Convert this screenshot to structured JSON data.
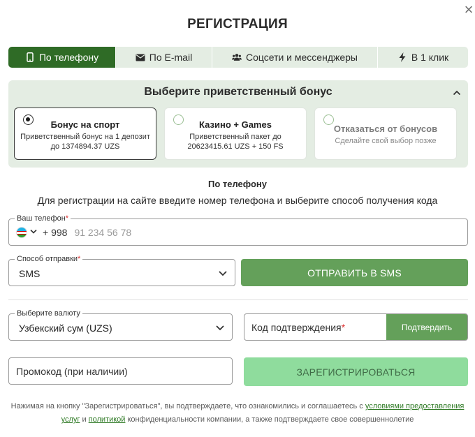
{
  "dialog": {
    "title": "РЕГИСТРАЦИЯ",
    "close_icon": "close-icon"
  },
  "tabs": [
    {
      "label": "По телефону",
      "icon": "phone-icon",
      "active": true
    },
    {
      "label": "По E-mail",
      "icon": "envelope-icon",
      "active": false
    },
    {
      "label": "Соцсети и мессенджеры",
      "icon": "users-icon",
      "active": false
    },
    {
      "label": "В 1 клик",
      "icon": "lightning-icon",
      "active": false
    }
  ],
  "bonus": {
    "title": "Выберите приветственный бонус",
    "options": [
      {
        "title": "Бонус на спорт",
        "desc": "Приветственный бонус на 1 депозит до 1374894.37 UZS",
        "selected": true
      },
      {
        "title": "Казино + Games",
        "desc": "Приветственный пакет до 20623415.61 UZS + 150 FS",
        "selected": false
      },
      {
        "title": "Отказаться от бонусов",
        "desc": "Сделайте свой выбор позже",
        "selected": false
      }
    ]
  },
  "section": {
    "title": "По телефону",
    "description": "Для регистрации на сайте введите номер телефона и выберите способ получения кода"
  },
  "phone": {
    "label": "Ваш телефон",
    "required_mark": "*",
    "country_code": "+ 998",
    "placeholder": "91 234 56 78"
  },
  "send_method": {
    "label": "Способ отправки",
    "required_mark": "*",
    "value": "SMS"
  },
  "send_button": {
    "label": "ОТПРАВИТЬ В SMS"
  },
  "currency": {
    "label": "Выберите валюту",
    "value": "Узбекский сум (UZS)"
  },
  "confirmation": {
    "label": "Код подтверждения",
    "required_mark": "*",
    "button": "Подтвердить"
  },
  "promo": {
    "label": "Промокод (при наличии)"
  },
  "register_button": {
    "label": "ЗАРЕГИСТРИРОВАТЬСЯ"
  },
  "legal": {
    "text_before": "Нажимая на кнопку \"Зарегистрироваться\", вы подтверждаете, что ознакомились и соглашаетесь с ",
    "link_terms": "условиями предоставления услуг",
    "text_middle": " и ",
    "link_policy": "политикой",
    "text_after": " конфиденциальности компании, а также подтверждаете свое совершеннолетие"
  },
  "colors": {
    "accent_dark": "#2f6b26",
    "accent": "#64a05a",
    "register_bg": "#8fdc9d",
    "panel_bg": "#e4ede3"
  }
}
